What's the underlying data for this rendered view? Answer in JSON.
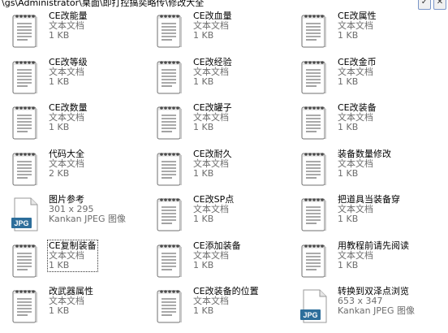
{
  "window": {
    "address_text": "\\gs\\Administrator\\桌面\\即打控搞奕略传\\修改大全",
    "buttons": [
      "✓",
      "✕"
    ]
  },
  "files": [
    {
      "name": "CE改能量",
      "type": "文本文档",
      "size": "1 KB",
      "icon": "text-file-icon"
    },
    {
      "name": "CE改血量",
      "type": "文本文档",
      "size": "1 KB",
      "icon": "text-file-icon"
    },
    {
      "name": "CE改属性",
      "type": "文本文档",
      "size": "1 KB",
      "icon": "text-file-icon"
    },
    {
      "name": "CE改等级",
      "type": "文本文档",
      "size": "1 KB",
      "icon": "text-file-icon"
    },
    {
      "name": "CE改经验",
      "type": "文本文档",
      "size": "1 KB",
      "icon": "text-file-icon"
    },
    {
      "name": "CE改金币",
      "type": "文本文档",
      "size": "1 KB",
      "icon": "text-file-icon"
    },
    {
      "name": "CE改数量",
      "type": "文本文档",
      "size": "1 KB",
      "icon": "text-file-icon"
    },
    {
      "name": "CE改罐子",
      "type": "文本文档",
      "size": "1 KB",
      "icon": "text-file-icon"
    },
    {
      "name": "CE改装备",
      "type": "文本文档",
      "size": "1 KB",
      "icon": "text-file-icon"
    },
    {
      "name": "代码大全",
      "type": "文本文档",
      "size": "2 KB",
      "icon": "text-file-icon"
    },
    {
      "name": "CE改耐久",
      "type": "文本文档",
      "size": "1 KB",
      "icon": "text-file-icon"
    },
    {
      "name": "装备数量修改",
      "type": "文本文档",
      "size": "1 KB",
      "icon": "text-file-icon"
    },
    {
      "name": "图片参考",
      "type": "301 x 295",
      "size": "Kankan JPEG 图像",
      "icon": "jpg-file-icon"
    },
    {
      "name": "CE改SP点",
      "type": "文本文档",
      "size": "1 KB",
      "icon": "text-file-icon"
    },
    {
      "name": "把道具当装备穿",
      "type": "文本文档",
      "size": "1 KB",
      "icon": "text-file-icon"
    },
    {
      "name": "CE复制装备",
      "type": "文本文档",
      "size": "1 KB",
      "icon": "text-file-icon",
      "focused": true
    },
    {
      "name": "CE添加装备",
      "type": "文本文档",
      "size": "1 KB",
      "icon": "text-file-icon"
    },
    {
      "name": "用教程前请先阅读",
      "type": "文本文档",
      "size": "1 KB",
      "icon": "text-file-icon"
    },
    {
      "name": "改武器属性",
      "type": "文本文档",
      "size": "1 KB",
      "icon": "text-file-icon"
    },
    {
      "name": "CE改装备的位置",
      "type": "文本文档",
      "size": "1 KB",
      "icon": "text-file-icon"
    },
    {
      "name": "转换到双泽点浏览",
      "type": "653 x 347",
      "size": "Kankan JPEG 图像",
      "icon": "jpg-file-icon"
    }
  ],
  "jpg_badge": "JPG"
}
